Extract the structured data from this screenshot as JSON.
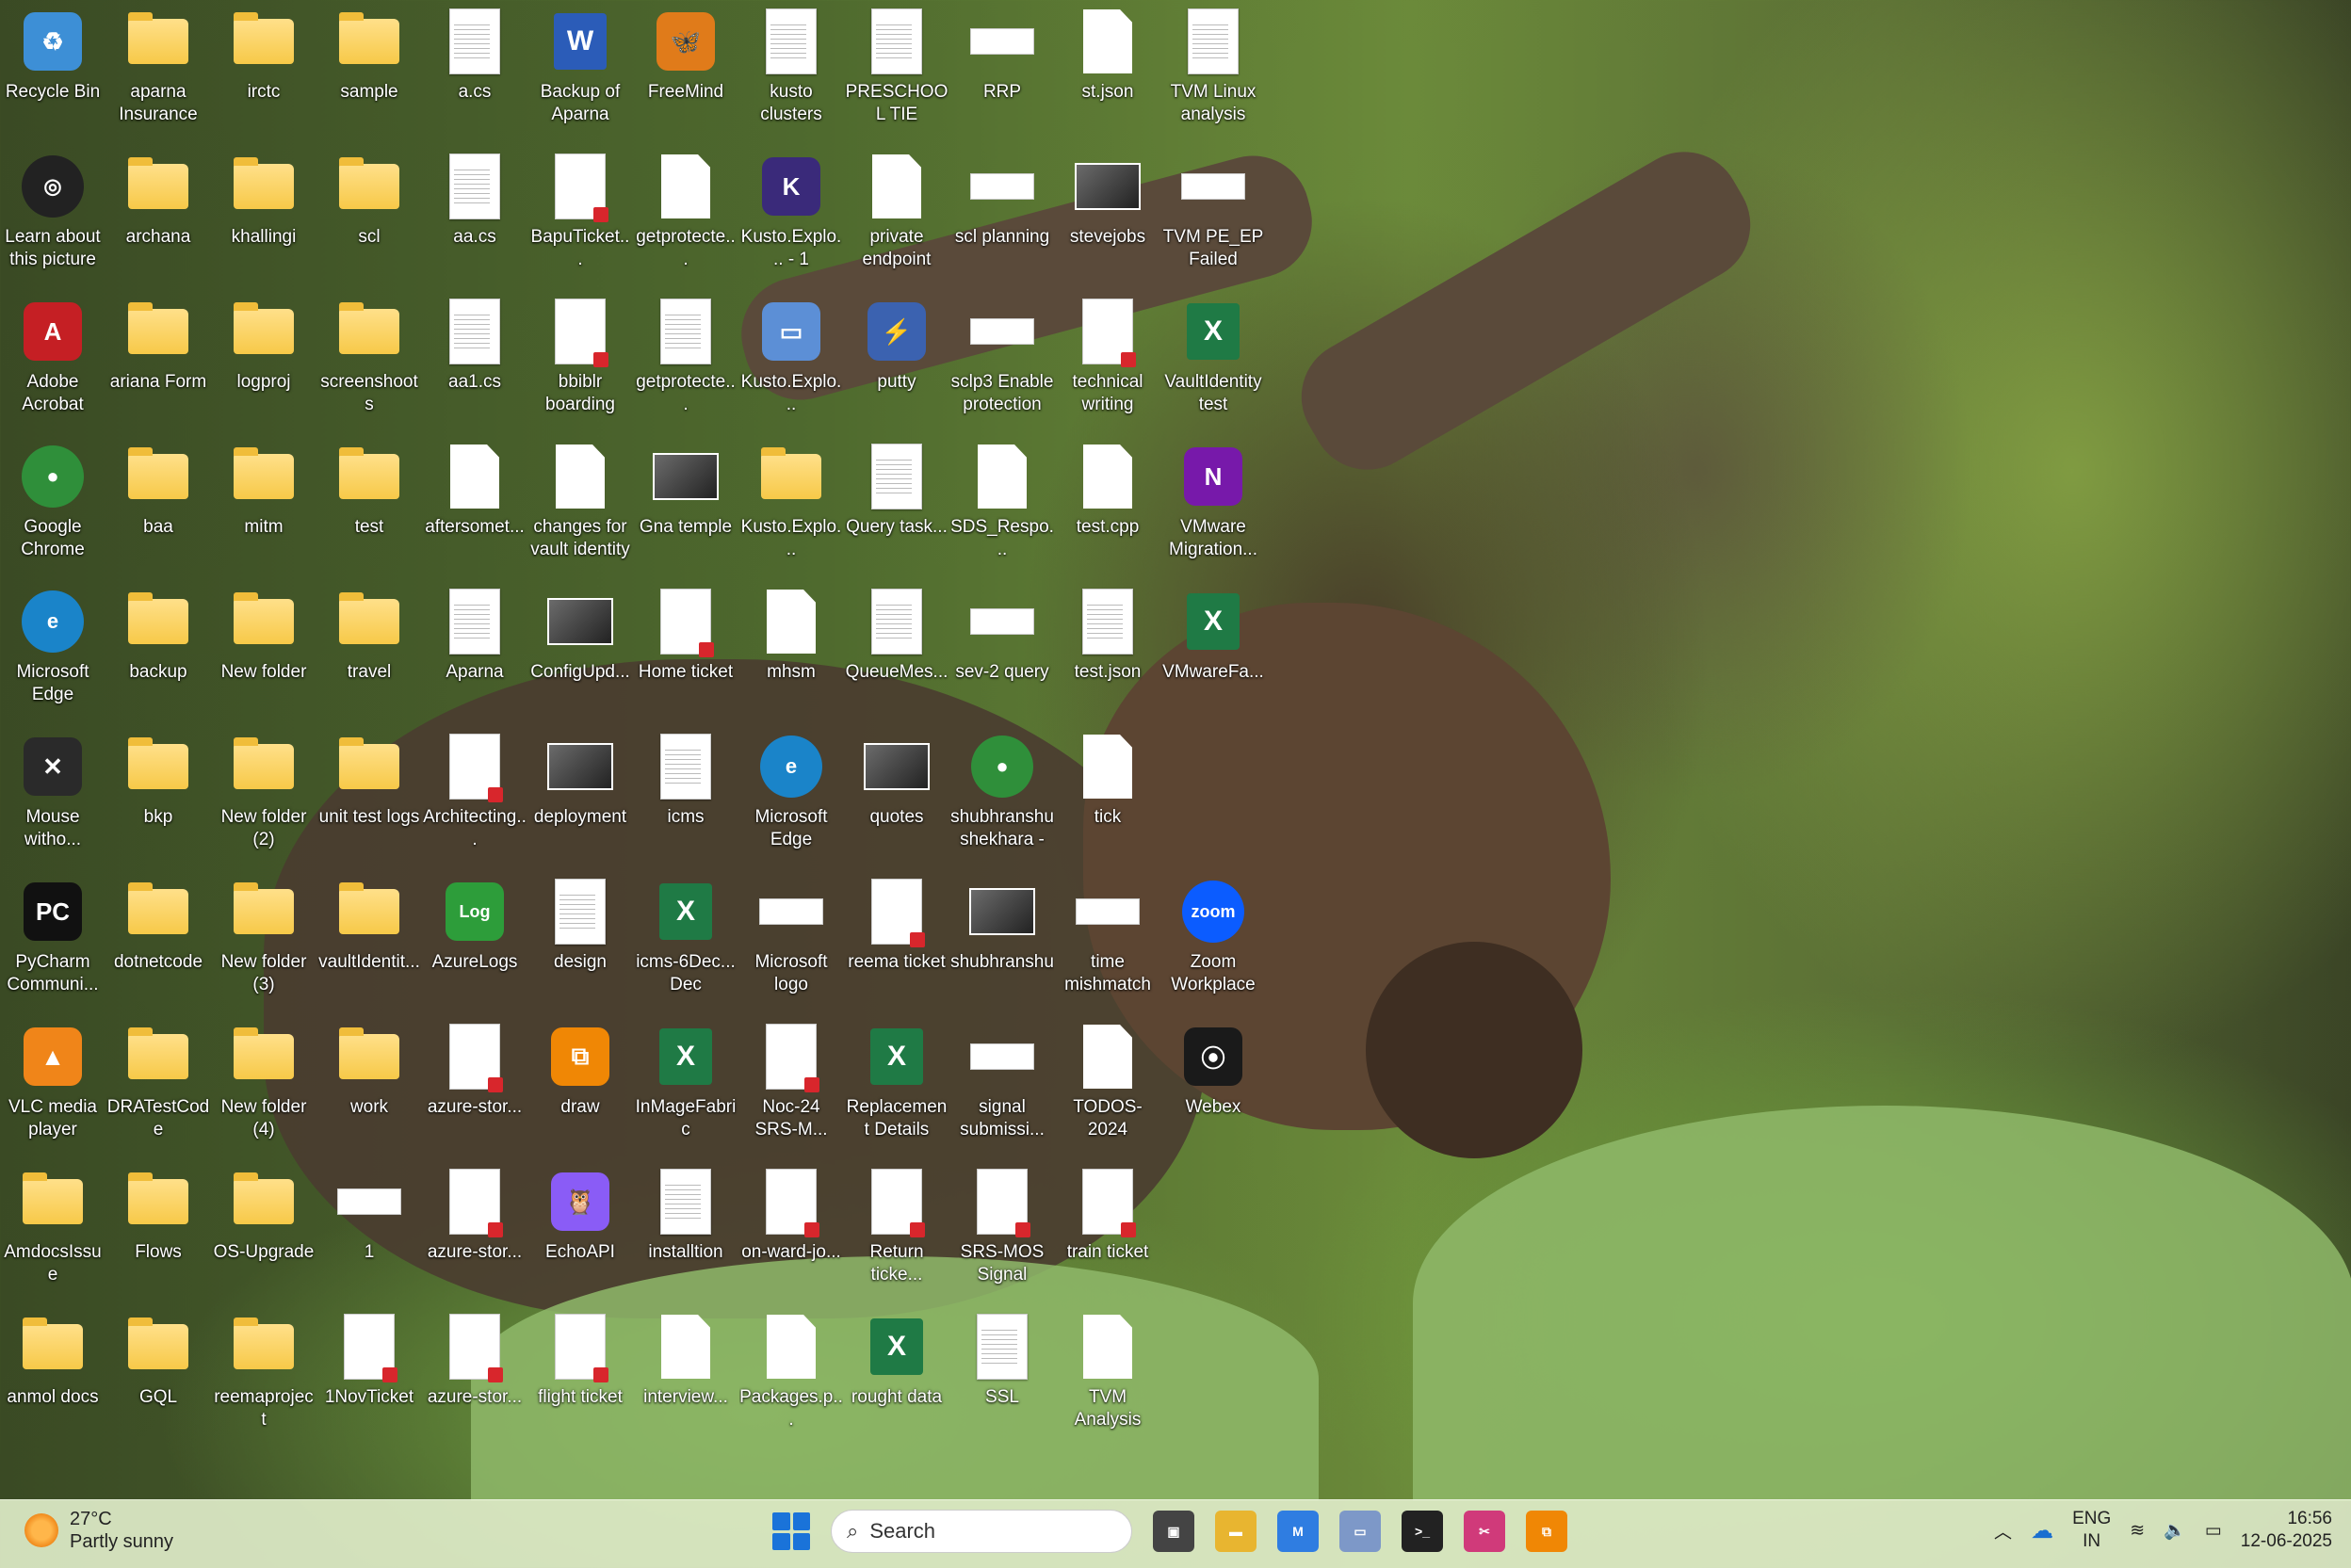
{
  "desktop": {
    "columns": [
      [
        {
          "label": "Recycle Bin",
          "icon": "recycle-bin-icon",
          "type": "app",
          "color": "#3d8fd6",
          "glyph": "♻"
        },
        {
          "label": "Learn about this picture",
          "icon": "camera-icon",
          "type": "round",
          "color": "#222222",
          "glyph": "◎"
        },
        {
          "label": "Adobe Acrobat",
          "icon": "adobe-acrobat-icon",
          "type": "app",
          "color": "#c51f24",
          "glyph": "A"
        },
        {
          "label": "Google Chrome",
          "icon": "chrome-icon",
          "type": "round",
          "color": "#2f8f3a",
          "glyph": "●"
        },
        {
          "label": "Microsoft Edge",
          "icon": "edge-icon",
          "type": "round",
          "color": "#1a84c9",
          "glyph": "e"
        },
        {
          "label": "Mouse witho...",
          "icon": "mouse-without-borders-icon",
          "type": "app",
          "color": "#2a2a2a",
          "glyph": "✕"
        },
        {
          "label": "PyCharm Communi...",
          "icon": "pycharm-icon",
          "type": "app",
          "color": "#111111",
          "glyph": "PC"
        },
        {
          "label": "VLC media player",
          "icon": "vlc-icon",
          "type": "app",
          "color": "#f08519",
          "glyph": "▲"
        },
        {
          "label": "AmdocsIssue",
          "icon": "folder-icon",
          "type": "folder"
        },
        {
          "label": "anmol docs",
          "icon": "folder-icon",
          "type": "folder"
        }
      ],
      [
        {
          "label": "aparna Insurance",
          "icon": "folder-icon",
          "type": "folder"
        },
        {
          "label": "archana",
          "icon": "folder-icon",
          "type": "folder"
        },
        {
          "label": "ariana Form",
          "icon": "folder-icon",
          "type": "folder"
        },
        {
          "label": "baa",
          "icon": "folder-icon",
          "type": "folder"
        },
        {
          "label": "backup",
          "icon": "folder-icon",
          "type": "folder"
        },
        {
          "label": "bkp",
          "icon": "folder-icon",
          "type": "folder"
        },
        {
          "label": "dotnetcode",
          "icon": "folder-icon",
          "type": "folder"
        },
        {
          "label": "DRATestCode",
          "icon": "folder-icon",
          "type": "folder"
        },
        {
          "label": "Flows",
          "icon": "folder-icon",
          "type": "folder"
        },
        {
          "label": "GQL",
          "icon": "folder-icon",
          "type": "folder"
        }
      ],
      [
        {
          "label": "irctc",
          "icon": "folder-icon",
          "type": "folder"
        },
        {
          "label": "khallingi",
          "icon": "folder-icon",
          "type": "folder"
        },
        {
          "label": "logproj",
          "icon": "folder-icon",
          "type": "folder"
        },
        {
          "label": "mitm",
          "icon": "folder-icon",
          "type": "folder"
        },
        {
          "label": "New folder",
          "icon": "folder-icon",
          "type": "folder"
        },
        {
          "label": "New folder (2)",
          "icon": "folder-icon",
          "type": "folder"
        },
        {
          "label": "New folder (3)",
          "icon": "folder-icon",
          "type": "folder"
        },
        {
          "label": "New folder (4)",
          "icon": "folder-icon",
          "type": "folder"
        },
        {
          "label": "OS-Upgrade",
          "icon": "folder-icon",
          "type": "folder"
        },
        {
          "label": "reemaproject",
          "icon": "folder-icon",
          "type": "folder"
        }
      ],
      [
        {
          "label": "sample",
          "icon": "folder-icon",
          "type": "folder"
        },
        {
          "label": "scl",
          "icon": "folder-icon",
          "type": "folder"
        },
        {
          "label": "screenshoots",
          "icon": "folder-icon",
          "type": "folder"
        },
        {
          "label": "test",
          "icon": "folder-icon",
          "type": "folder"
        },
        {
          "label": "travel",
          "icon": "folder-icon",
          "type": "folder"
        },
        {
          "label": "unit test logs",
          "icon": "folder-icon",
          "type": "folder"
        },
        {
          "label": "vaultIdentit...",
          "icon": "folder-icon",
          "type": "folder"
        },
        {
          "label": "work",
          "icon": "folder-icon",
          "type": "folder"
        },
        {
          "label": "1",
          "icon": "image-file-icon",
          "type": "wide"
        },
        {
          "label": "1NovTicket",
          "icon": "pdf-file-icon",
          "type": "pdf"
        }
      ],
      [
        {
          "label": "a.cs",
          "icon": "cs-file-icon",
          "type": "doc"
        },
        {
          "label": "aa.cs",
          "icon": "cs-file-icon",
          "type": "doc"
        },
        {
          "label": "aa1.cs",
          "icon": "cs-file-icon",
          "type": "doc"
        },
        {
          "label": "aftersomet...",
          "icon": "blank-file-icon",
          "type": "blank"
        },
        {
          "label": "Aparna",
          "icon": "word-file-icon",
          "type": "doc"
        },
        {
          "label": "Architecting...",
          "icon": "pdf-file-icon",
          "type": "pdf"
        },
        {
          "label": "AzureLogs",
          "icon": "log-file-icon",
          "type": "app",
          "color": "#2d9d3a",
          "glyph": "Log"
        },
        {
          "label": "azure-stor...",
          "icon": "pdf-file-icon",
          "type": "pdf"
        },
        {
          "label": "azure-stor...",
          "icon": "pdf-file-icon",
          "type": "pdf"
        },
        {
          "label": "azure-stor...",
          "icon": "pdf-file-icon",
          "type": "pdf"
        }
      ],
      [
        {
          "label": "Backup of Aparna",
          "icon": "word-icon",
          "type": "word",
          "glyph": "W"
        },
        {
          "label": "BapuTicket...",
          "icon": "pdf-file-icon",
          "type": "pdf"
        },
        {
          "label": "bbiblr boarding",
          "icon": "pdf-file-icon",
          "type": "pdf"
        },
        {
          "label": "changes for vault identity",
          "icon": "blank-file-icon",
          "type": "blank"
        },
        {
          "label": "ConfigUpd...",
          "icon": "image-file-icon",
          "type": "img"
        },
        {
          "label": "deployment",
          "icon": "image-file-icon",
          "type": "img"
        },
        {
          "label": "design",
          "icon": "document-icon",
          "type": "doc"
        },
        {
          "label": "draw",
          "icon": "drawio-icon",
          "type": "app",
          "color": "#f08705",
          "glyph": "⧉"
        },
        {
          "label": "EchoAPI",
          "icon": "echoapi-icon",
          "type": "app",
          "color": "#8a5cf6",
          "glyph": "🦉"
        },
        {
          "label": "flight ticket",
          "icon": "pdf-file-icon",
          "type": "pdf"
        }
      ],
      [
        {
          "label": "FreeMind",
          "icon": "freemind-icon",
          "type": "app",
          "color": "#e07b1a",
          "glyph": "🦋"
        },
        {
          "label": "getprotecte...",
          "icon": "blank-file-icon",
          "type": "blank"
        },
        {
          "label": "getprotecte...",
          "icon": "document-icon",
          "type": "doc"
        },
        {
          "label": "Gna temple",
          "icon": "image-file-icon",
          "type": "img"
        },
        {
          "label": "Home ticket",
          "icon": "pdf-file-icon",
          "type": "pdf"
        },
        {
          "label": "icms",
          "icon": "document-icon",
          "type": "doc"
        },
        {
          "label": "icms-6Dec... Dec",
          "icon": "excel-file-icon",
          "type": "excel",
          "glyph": "X"
        },
        {
          "label": "InMageFabric",
          "icon": "excel-icon",
          "type": "excel",
          "glyph": "X"
        },
        {
          "label": "installtion",
          "icon": "document-icon",
          "type": "doc"
        },
        {
          "label": "interview...",
          "icon": "blank-file-icon",
          "type": "blank"
        }
      ],
      [
        {
          "label": "kusto clusters",
          "icon": "document-icon",
          "type": "doc"
        },
        {
          "label": "Kusto.Explo... - 1",
          "icon": "kusto-explorer-icon",
          "type": "app",
          "color": "#3a2a7a",
          "glyph": "K"
        },
        {
          "label": "Kusto.Explo...",
          "icon": "kusto-explorer-icon",
          "type": "app",
          "color": "#5c8fd6",
          "glyph": "▭"
        },
        {
          "label": "Kusto.Explo...",
          "icon": "zip-folder-icon",
          "type": "folder"
        },
        {
          "label": "mhsm",
          "icon": "document-icon",
          "type": "blank"
        },
        {
          "label": "Microsoft Edge",
          "icon": "edge-icon",
          "type": "round",
          "color": "#1a84c9",
          "glyph": "e"
        },
        {
          "label": "Microsoft logo",
          "icon": "image-file-icon",
          "type": "wide"
        },
        {
          "label": "Noc-24 SRS-M...",
          "icon": "pdf-file-icon",
          "type": "pdf"
        },
        {
          "label": "on-ward-jo...",
          "icon": "pdf-file-icon",
          "type": "pdf"
        },
        {
          "label": "Packages.p...",
          "icon": "package-file-icon",
          "type": "blank"
        }
      ],
      [
        {
          "label": "PRESCHOOL TIE",
          "icon": "word-file-icon",
          "type": "doc"
        },
        {
          "label": "private endpoint",
          "icon": "blank-file-icon",
          "type": "blank"
        },
        {
          "label": "putty",
          "icon": "putty-icon",
          "type": "app",
          "color": "#3b62b0",
          "glyph": "⚡"
        },
        {
          "label": "Query task...",
          "icon": "document-icon",
          "type": "doc"
        },
        {
          "label": "QueueMes...",
          "icon": "document-icon",
          "type": "doc"
        },
        {
          "label": "quotes",
          "icon": "image-file-icon",
          "type": "img"
        },
        {
          "label": "reema ticket",
          "icon": "pdf-file-icon",
          "type": "pdf"
        },
        {
          "label": "Replacement Details",
          "icon": "excel-icon",
          "type": "excel",
          "glyph": "X"
        },
        {
          "label": "Return ticke...",
          "icon": "pdf-file-icon",
          "type": "pdf"
        },
        {
          "label": "rought data",
          "icon": "excel-icon",
          "type": "excel",
          "glyph": "X"
        }
      ],
      [
        {
          "label": "RRP",
          "icon": "image-file-icon",
          "type": "wide"
        },
        {
          "label": "scl planning",
          "icon": "image-file-icon",
          "type": "wide"
        },
        {
          "label": "sclp3 Enable protection",
          "icon": "image-file-icon",
          "type": "wide"
        },
        {
          "label": "SDS_Respo...",
          "icon": "blank-file-icon",
          "type": "blank"
        },
        {
          "label": "sev-2 query",
          "icon": "image-file-icon",
          "type": "wide"
        },
        {
          "label": "shubhranshu shekhara - ...",
          "icon": "chrome-profile-icon",
          "type": "round",
          "color": "#2f8f3a",
          "glyph": "●"
        },
        {
          "label": "shubhranshu",
          "icon": "photo-icon",
          "type": "img"
        },
        {
          "label": "signal submissi...",
          "icon": "image-file-icon",
          "type": "wide"
        },
        {
          "label": "SRS-MOS Signal",
          "icon": "pdf-file-icon",
          "type": "pdf"
        },
        {
          "label": "SSL",
          "icon": "document-icon",
          "type": "doc"
        }
      ],
      [
        {
          "label": "st.json",
          "icon": "blank-file-icon",
          "type": "blank"
        },
        {
          "label": "stevejobs",
          "icon": "image-file-icon",
          "type": "img"
        },
        {
          "label": "technical writing",
          "icon": "pdf-file-icon",
          "type": "pdf"
        },
        {
          "label": "test.cpp",
          "icon": "blank-file-icon",
          "type": "blank"
        },
        {
          "label": "test.json",
          "icon": "document-icon",
          "type": "doc"
        },
        {
          "label": "tick",
          "icon": "blank-file-icon",
          "type": "blank"
        },
        {
          "label": "time mishmatch ...",
          "icon": "image-file-icon",
          "type": "wide"
        },
        {
          "label": "TODOS-2024",
          "icon": "blank-file-icon",
          "type": "blank"
        },
        {
          "label": "train ticket",
          "icon": "pdf-file-icon",
          "type": "pdf"
        },
        {
          "label": "TVM Analysis",
          "icon": "blank-file-icon",
          "type": "blank"
        }
      ],
      [
        {
          "label": "TVM Linux analysis",
          "icon": "document-icon",
          "type": "doc"
        },
        {
          "label": "TVM PE_EP Failed",
          "icon": "image-file-icon",
          "type": "wide"
        },
        {
          "label": "VaultIdentity test",
          "icon": "excel-icon",
          "type": "excel",
          "glyph": "X"
        },
        {
          "label": "VMware Migration...",
          "icon": "onenote-icon",
          "type": "app",
          "color": "#7719aa",
          "glyph": "N"
        },
        {
          "label": "VMwareFa...",
          "icon": "excel-icon",
          "type": "excel",
          "glyph": "X"
        },
        {
          "label": "",
          "icon": "",
          "type": "empty"
        },
        {
          "label": "Zoom Workplace",
          "icon": "zoom-icon",
          "type": "round",
          "color": "#0b5cff",
          "glyph": "zoom"
        },
        {
          "label": "Webex",
          "icon": "webex-icon",
          "type": "app",
          "color": "#1a1a1a",
          "glyph": "⦿"
        },
        {
          "label": "",
          "icon": "",
          "type": "empty"
        },
        {
          "label": "",
          "icon": "",
          "type": "empty"
        }
      ]
    ]
  },
  "taskbar": {
    "weather": {
      "temp": "27°C",
      "condition": "Partly sunny",
      "icon": "partly-sunny-icon"
    },
    "search_placeholder": "Search",
    "apps": [
      {
        "name": "task-view-icon",
        "color": "#444444",
        "glyph": "▣"
      },
      {
        "name": "file-explorer-icon",
        "color": "#e8b530",
        "glyph": "▬"
      },
      {
        "name": "copilot-m365-icon",
        "color": "#2f7de1",
        "glyph": "M"
      },
      {
        "name": "window-app-icon",
        "color": "#7d98c8",
        "glyph": "▭"
      },
      {
        "name": "terminal-icon",
        "color": "#222222",
        "glyph": ">_"
      },
      {
        "name": "snipping-tool-icon",
        "color": "#d03a7a",
        "glyph": "✂"
      },
      {
        "name": "drawio-icon",
        "color": "#f08705",
        "glyph": "⧉"
      }
    ],
    "tray": {
      "language_line1": "ENG",
      "language_line2": "IN",
      "time": "16:56",
      "date": "12-06-2025"
    }
  }
}
